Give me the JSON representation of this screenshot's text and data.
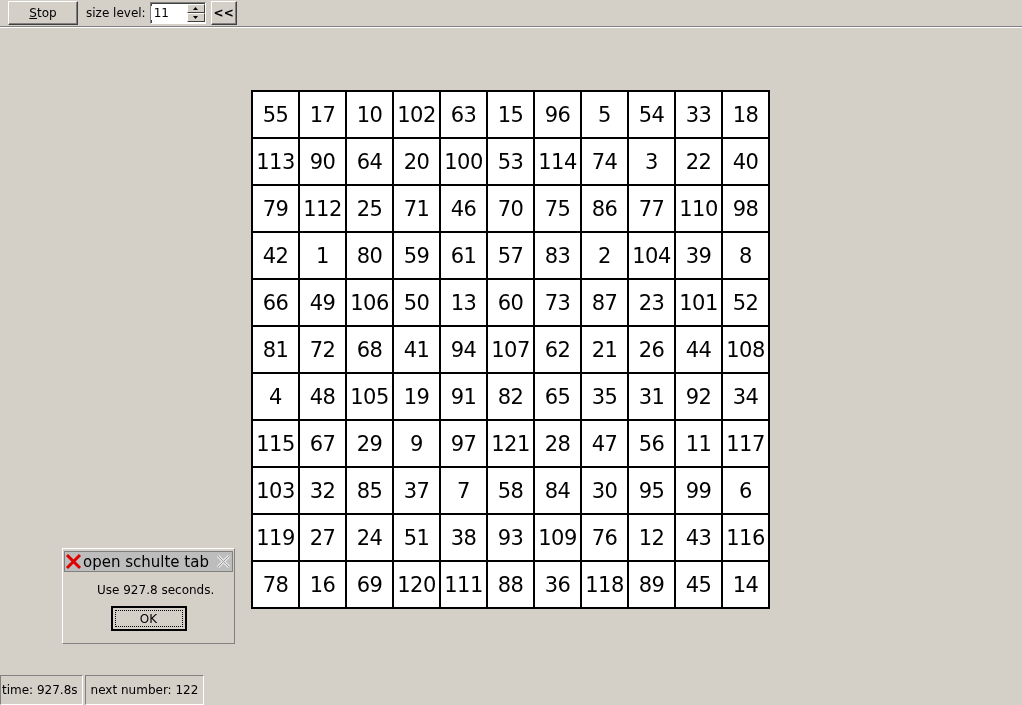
{
  "toolbar": {
    "stop_button": "Stop",
    "size_label": "size level:",
    "size_value": "11",
    "collapse_button": "<<"
  },
  "grid": {
    "rows": [
      [
        "55",
        "17",
        "10",
        "102",
        "63",
        "15",
        "96",
        "5",
        "54",
        "33",
        "18"
      ],
      [
        "113",
        "90",
        "64",
        "20",
        "100",
        "53",
        "114",
        "74",
        "3",
        "22",
        "40"
      ],
      [
        "79",
        "112",
        "25",
        "71",
        "46",
        "70",
        "75",
        "86",
        "77",
        "110",
        "98"
      ],
      [
        "42",
        "1",
        "80",
        "59",
        "61",
        "57",
        "83",
        "2",
        "104",
        "39",
        "8"
      ],
      [
        "66",
        "49",
        "106",
        "50",
        "13",
        "60",
        "73",
        "87",
        "23",
        "101",
        "52"
      ],
      [
        "81",
        "72",
        "68",
        "41",
        "94",
        "107",
        "62",
        "21",
        "26",
        "44",
        "108"
      ],
      [
        "4",
        "48",
        "105",
        "19",
        "91",
        "82",
        "65",
        "35",
        "31",
        "92",
        "34"
      ],
      [
        "115",
        "67",
        "29",
        "9",
        "97",
        "121",
        "28",
        "47",
        "56",
        "11",
        "117"
      ],
      [
        "103",
        "32",
        "85",
        "37",
        "7",
        "58",
        "84",
        "30",
        "95",
        "99",
        "6"
      ],
      [
        "119",
        "27",
        "24",
        "51",
        "38",
        "93",
        "109",
        "76",
        "12",
        "43",
        "116"
      ],
      [
        "78",
        "16",
        "69",
        "120",
        "111",
        "88",
        "36",
        "118",
        "89",
        "45",
        "14"
      ]
    ]
  },
  "dialog": {
    "title": "open schulte tab",
    "message": "Use 927.8 seconds.",
    "button": "OK"
  },
  "status_bar": [
    "time: 927.8s",
    "next number: 122"
  ]
}
